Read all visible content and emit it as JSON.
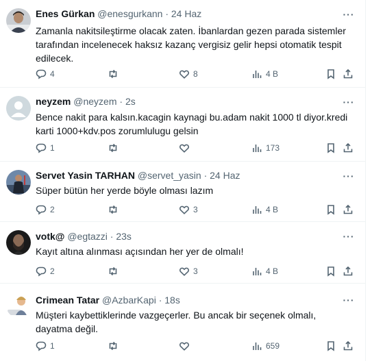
{
  "tweets": [
    {
      "name": "Enes Gürkan",
      "handle": "@enesgurkann",
      "time": "24 Haz",
      "text": "Zamanla nakitsileştirme olacak zaten. İbanlardan gezen parada sistemler tarafından incelenecek haksız kazanç vergisiz gelir hepsi otomatik tespit edilecek.",
      "replies": "4",
      "reposts": "",
      "likes": "8",
      "views": "4 B"
    },
    {
      "name": "neyzem",
      "handle": "@neyzem",
      "time": "2s",
      "text": "Bence nakit para kalsın.kacagin kaynagi bu.adam nakit 1000 tl diyor.kredi karti 1000+kdv.pos zorumlulugu gelsin",
      "replies": "1",
      "reposts": "",
      "likes": "",
      "views": "173"
    },
    {
      "name": "Servet Yasin TARHAN",
      "handle": "@servet_yasin",
      "time": "24 Haz",
      "text": "Süper bütün her yerde böyle olması lazım",
      "replies": "2",
      "reposts": "",
      "likes": "3",
      "views": "4 B"
    },
    {
      "name": "votk@",
      "handle": "@egtazzi",
      "time": "23s",
      "text": "Kayıt altına alınması açısından her yer de olmalı!",
      "replies": "2",
      "reposts": "",
      "likes": "3",
      "views": "4 B"
    },
    {
      "name": "Crimean Tatar",
      "handle": "@AzbarKapi",
      "time": "18s",
      "text": "Müşteri kaybettiklerinde vazgeçerler. Bu ancak bir seçenek olmalı, dayatma değil.",
      "replies": "1",
      "reposts": "",
      "likes": "",
      "views": "659"
    }
  ],
  "ui": {
    "dot": "·",
    "more": "···"
  },
  "colors": {
    "text": "#0f1419",
    "secondary": "#536471",
    "border": "#eff3f4"
  },
  "icons": [
    "reply-icon",
    "repost-icon",
    "like-icon",
    "views-icon",
    "bookmark-icon",
    "share-icon",
    "more-icon"
  ]
}
